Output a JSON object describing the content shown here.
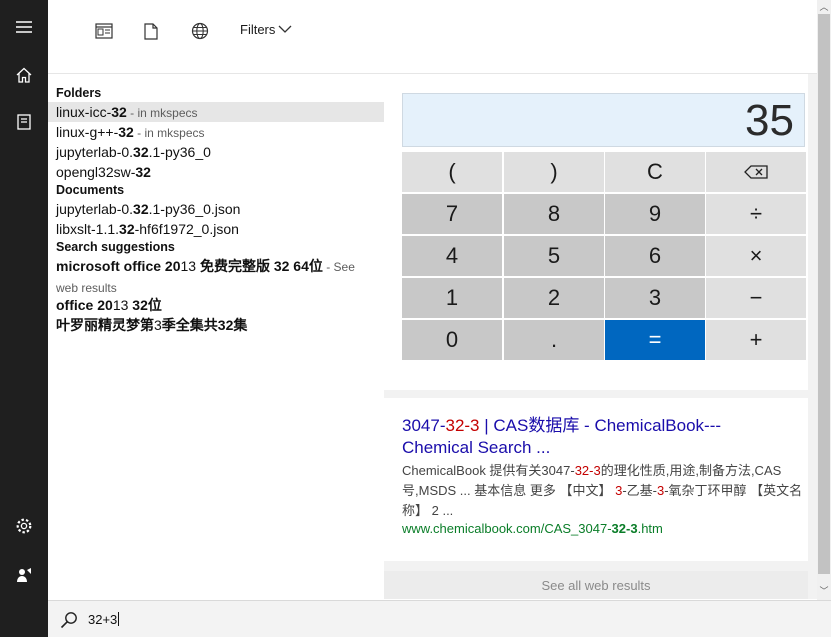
{
  "rail": {
    "items": [
      "hamburger-menu-icon",
      "home-icon",
      "documents-icon",
      "settings-icon",
      "user-feedback-icon"
    ]
  },
  "toolbar": {
    "icons": [
      "apps-icon",
      "document-icon",
      "web-icon"
    ],
    "filters_label": "Filters"
  },
  "results": {
    "folders_header": "Folders",
    "folders": [
      {
        "pre": "linux-icc-",
        "bold": "32",
        "meta": " - in mkspecs"
      },
      {
        "pre": "linux-g++-",
        "bold": "32",
        "meta": " - in mkspecs"
      },
      {
        "pre": "jupyterlab-0.",
        "bold": "32",
        "post": ".1-py36_0"
      },
      {
        "pre": "opengl32sw-",
        "bold": "32"
      }
    ],
    "documents_header": "Documents",
    "documents": [
      {
        "pre": "jupyterlab-0.",
        "bold": "32",
        "post": ".1-py36_0.json"
      },
      {
        "pre": "libxslt-1.1.",
        "bold": "32",
        "post": "-hf6f1972_0.json"
      }
    ],
    "suggestions_header": "Search suggestions",
    "suggestions": [
      {
        "pre": "microsoft office 20",
        "norm": "13",
        "bold": " 免费完整版 32 64位",
        "meta": " - See web results"
      },
      {
        "pre": "office 20",
        "norm": "13",
        "bold": " 32位"
      },
      {
        "pre": "叶罗丽精灵梦第",
        "norm": "3",
        "bold": "季全集共32集"
      }
    ]
  },
  "calculator": {
    "display": "35",
    "keys": [
      "(",
      ")",
      "C",
      "⌫",
      "7",
      "8",
      "9",
      "÷",
      "4",
      "5",
      "6",
      "×",
      "1",
      "2",
      "3",
      "−",
      "0",
      ".",
      "=",
      "+"
    ]
  },
  "web_result": {
    "title_pre": "3047-",
    "title_hl": "32-3",
    "title_post": " | CAS数据库 - ChemicalBook---Chemical Search ...",
    "desc_1": "ChemicalBook 提供有关3047-",
    "desc_hl1": "32-3",
    "desc_2": "的理化性质,用途,制备方法,CAS号,MSDS ... 基本信息 更多 【中文】 ",
    "desc_hl2": "3",
    "desc_3": "-乙基-",
    "desc_hl3": "3",
    "desc_4": "-氧杂丁环甲醇 【英文名称】 2 ...",
    "url_pre": "www.chemicalbook.com/CAS_3047-",
    "url_bold": "32-3",
    "url_post": ".htm"
  },
  "see_all": "See all web results",
  "search": {
    "value": "32+3"
  }
}
